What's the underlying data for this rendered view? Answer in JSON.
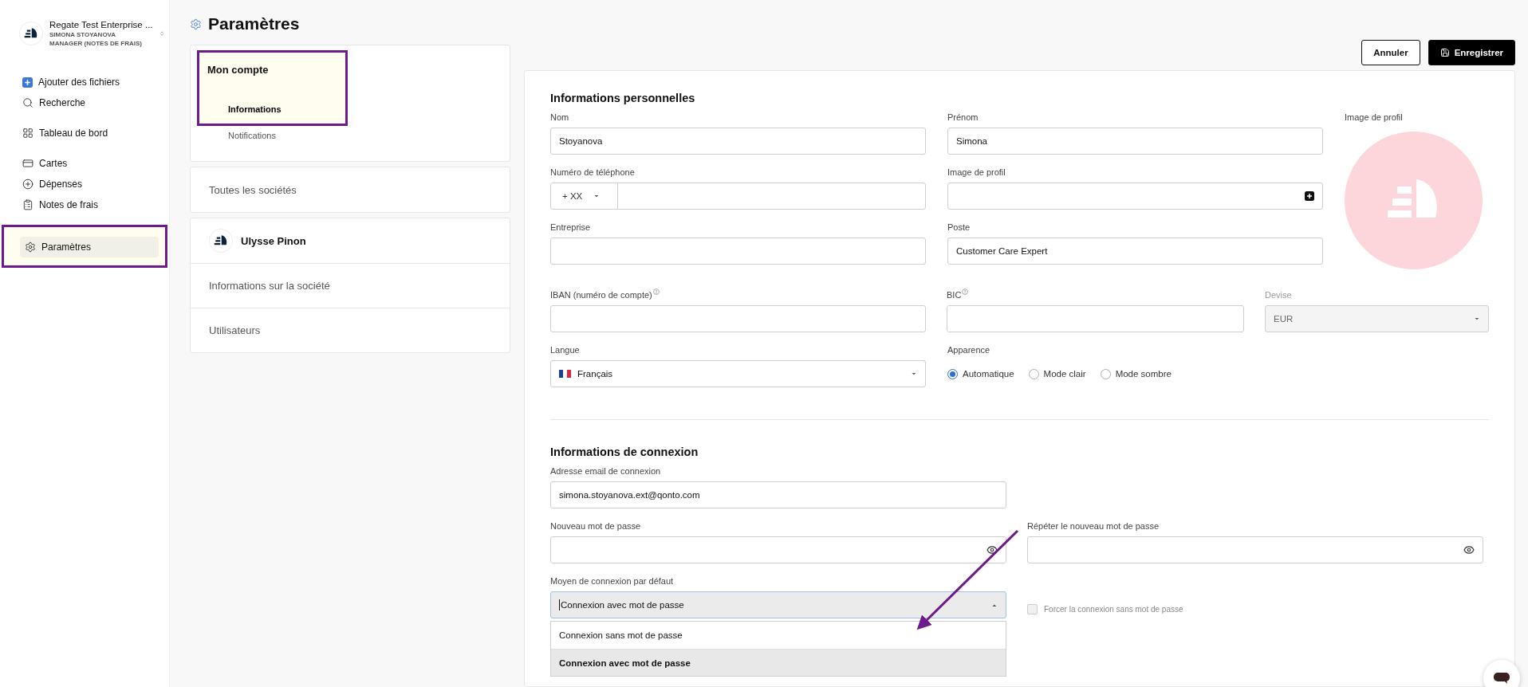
{
  "sidebar": {
    "account": {
      "company": "Regate Test Enterprise ...",
      "user": "SIMONA STOYANOVA",
      "role": "MANAGER (NOTES DE FRAIS)"
    },
    "groups": [
      {
        "items": [
          {
            "kind": "add",
            "label": "Ajouter des fichiers",
            "selected": false,
            "highlighted": false
          },
          {
            "kind": "search",
            "label": "Recherche",
            "selected": false,
            "highlighted": false
          }
        ]
      },
      {
        "items": [
          {
            "kind": "dashboard",
            "label": "Tableau de bord",
            "selected": false,
            "highlighted": false
          }
        ]
      },
      {
        "items": [
          {
            "kind": "card",
            "label": "Cartes",
            "selected": false,
            "highlighted": false
          },
          {
            "kind": "expense",
            "label": "Dépenses",
            "selected": false,
            "highlighted": false
          },
          {
            "kind": "report",
            "label": "Notes de frais",
            "selected": false,
            "highlighted": false
          }
        ]
      },
      {
        "items": [
          {
            "kind": "settings",
            "label": "Paramètres",
            "selected": true,
            "highlighted": true
          }
        ]
      }
    ]
  },
  "page_title": "Paramètres",
  "nav": {
    "account": {
      "title": "Mon compte",
      "highlighted": true,
      "items": [
        {
          "label": "Informations",
          "selected": true
        },
        {
          "label": "Notifications",
          "selected": false
        }
      ]
    },
    "all_companies": "Toutes les sociétés",
    "company": {
      "name": "Ulysse Pinon",
      "items": [
        {
          "label": "Informations sur la société"
        },
        {
          "label": "Utilisateurs"
        }
      ]
    }
  },
  "actions": {
    "cancel": "Annuler",
    "save": "Enregistrer"
  },
  "personal": {
    "title": "Informations personnelles",
    "last_name": {
      "label": "Nom",
      "value": "Stoyanova"
    },
    "first_name": {
      "label": "Prénom",
      "value": "Simona"
    },
    "avatar": {
      "label": "Image de profil"
    },
    "phone": {
      "label": "Numéro de téléphone",
      "prefix": "+ XX"
    },
    "profile_upload": {
      "label": "Image de profil"
    },
    "company": {
      "label": "Entreprise"
    },
    "position": {
      "label": "Poste",
      "value": "Customer Care Expert"
    },
    "iban": {
      "label": "IBAN (numéro de compte)"
    },
    "bic": {
      "label": "BIC"
    },
    "currency": {
      "label": "Devise",
      "value": "EUR",
      "disabled": true
    },
    "language": {
      "label": "Langue",
      "value": "Français"
    },
    "appearance": {
      "label": "Apparence",
      "options": [
        {
          "label": "Automatique",
          "selected": true
        },
        {
          "label": "Mode clair",
          "selected": false
        },
        {
          "label": "Mode sombre",
          "selected": false
        }
      ]
    }
  },
  "login": {
    "title": "Informations de connexion",
    "email": {
      "label": "Adresse email de connexion",
      "value": "simona.stoyanova.ext@qonto.com"
    },
    "password": {
      "label": "Nouveau mot de passe"
    },
    "repeat_password": {
      "label": "Répéter le nouveau mot de passe"
    },
    "default_method": {
      "label": "Moyen de connexion par défaut",
      "value": "Connexion avec mot de passe",
      "open": true,
      "options": [
        {
          "label": "Connexion sans mot de passe",
          "selected": false
        },
        {
          "label": "Connexion avec mot de passe",
          "selected": true
        }
      ]
    },
    "force_passwordless": {
      "label": "Forcer la connexion sans mot de passe",
      "checked": false,
      "disabled": true
    }
  }
}
